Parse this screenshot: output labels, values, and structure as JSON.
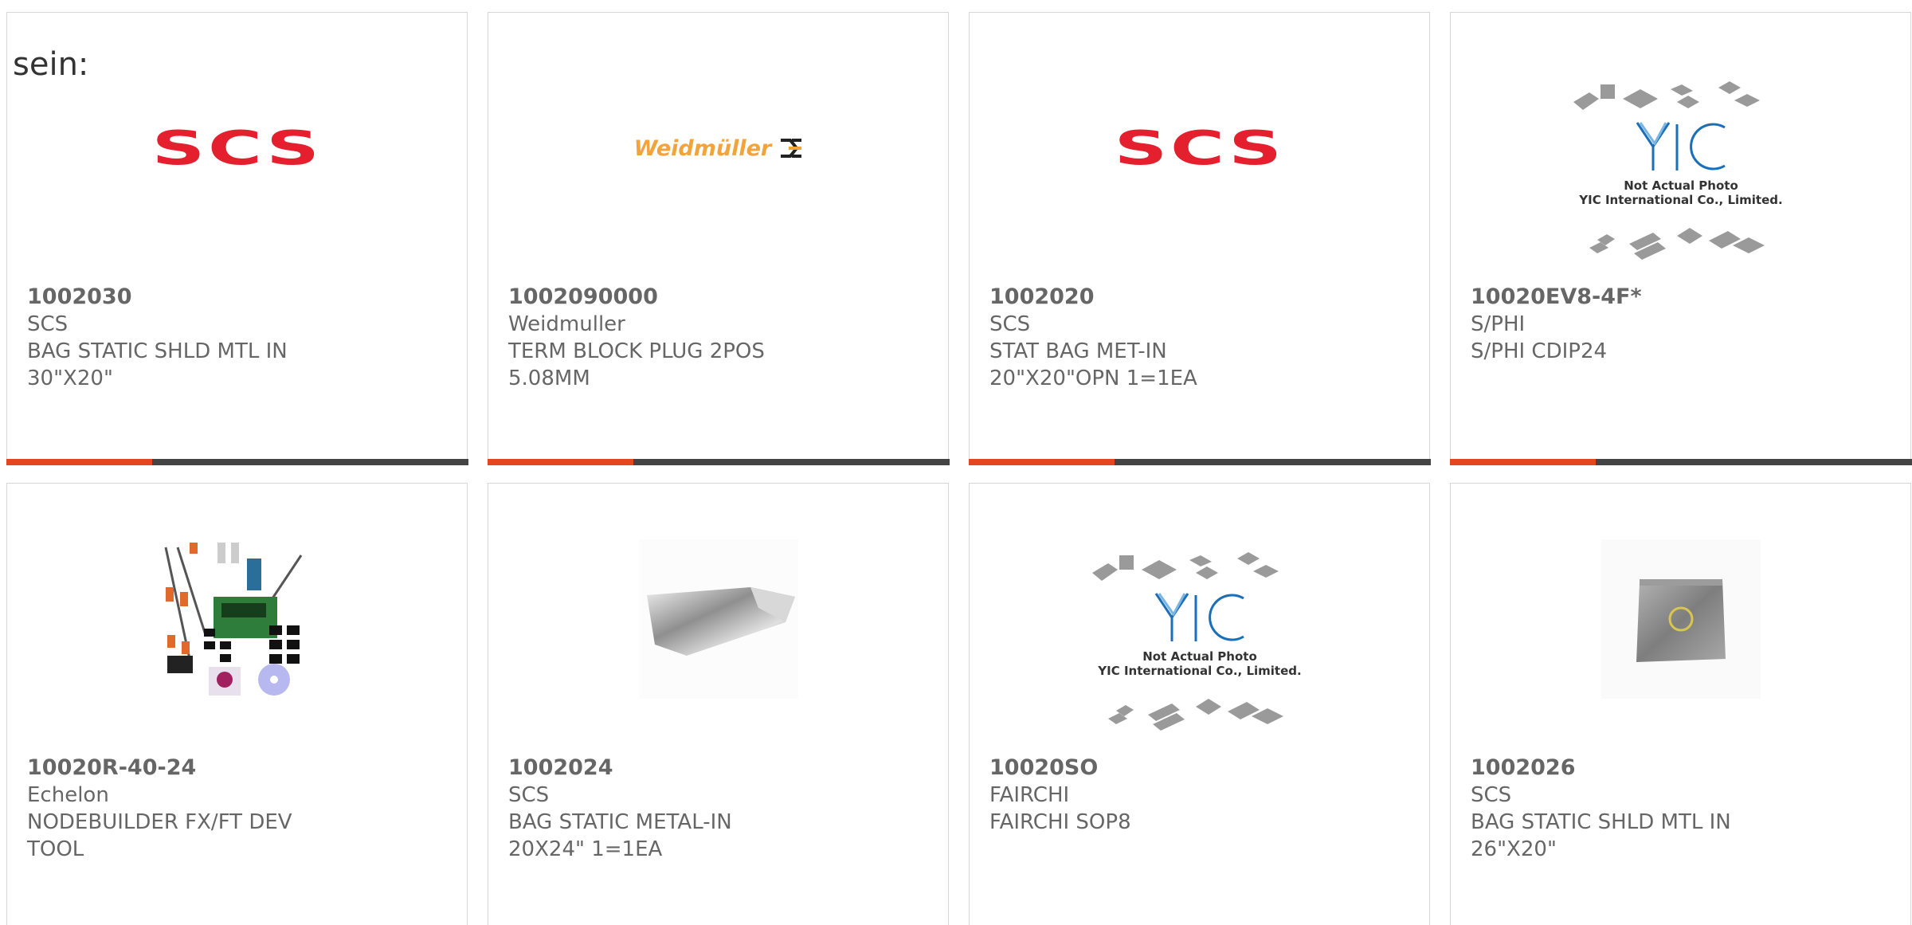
{
  "intro_text": "sein:",
  "products": [
    {
      "part": "1002030",
      "mfr": "SCS",
      "desc": "BAG STATIC SHLD MTL IN 30\"X20\"",
      "image": "scs-logo"
    },
    {
      "part": "1002090000",
      "mfr": "Weidmuller",
      "desc": "TERM BLOCK PLUG 2POS 5.08MM",
      "image": "weidmuller-logo"
    },
    {
      "part": "1002020",
      "mfr": "SCS",
      "desc": "STAT BAG MET-IN 20\"X20\"OPN 1=1EA",
      "image": "scs-logo"
    },
    {
      "part": "10020EV8-4F*",
      "mfr": "S/PHI",
      "desc": "S/PHI CDIP24",
      "image": "yic-placeholder"
    },
    {
      "part": "10020R-40-24",
      "mfr": "Echelon",
      "desc": "NODEBUILDER FX/FT DEV TOOL",
      "image": "dev-kit-photo"
    },
    {
      "part": "1002024",
      "mfr": "SCS",
      "desc": "BAG STATIC METAL-IN 20X24\" 1=1EA",
      "image": "static-bag-photo"
    },
    {
      "part": "10020SO",
      "mfr": "FAIRCHI",
      "desc": "FAIRCHI SOP8",
      "image": "yic-placeholder"
    },
    {
      "part": "1002026",
      "mfr": "SCS",
      "desc": "BAG STATIC SHLD MTL IN 26\"X20\"",
      "image": "static-bag-flat-photo"
    }
  ],
  "logos": {
    "scs": "SCS",
    "weidmuller": "Weidmüller",
    "yic_line1": "Not Actual Photo",
    "yic_line2": "YIC International Co., Limited."
  },
  "colors": {
    "accent": "#e4471f",
    "bar": "#444444",
    "scs_red": "#e5202e",
    "weidmuller_orange": "#f2a33a"
  }
}
